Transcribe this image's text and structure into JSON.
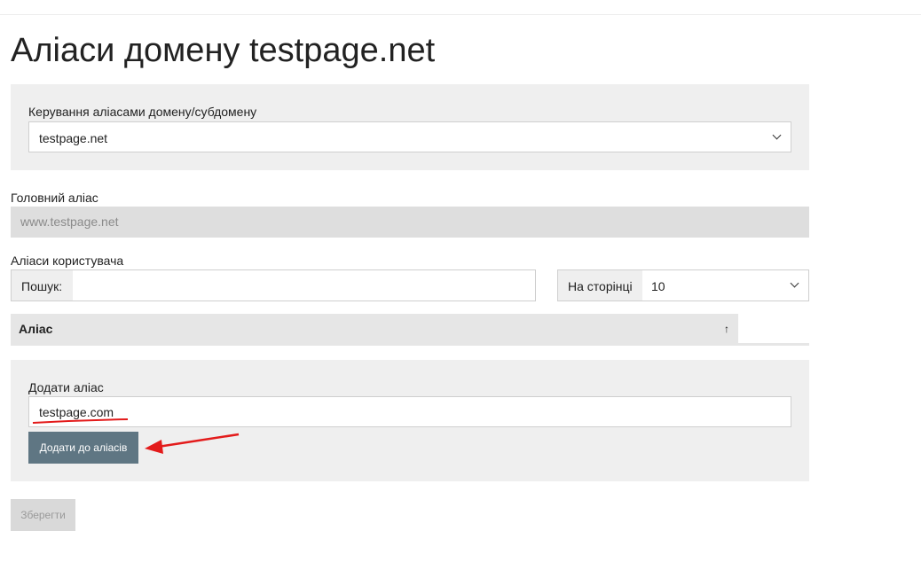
{
  "page": {
    "title": "Аліаси домену testpage.net"
  },
  "domain_select": {
    "label": "Керування аліасами домену/субдомену",
    "value": "testpage.net"
  },
  "main_alias": {
    "label": "Головний аліас",
    "value": "www.testpage.net"
  },
  "user_aliases": {
    "label": "Аліаси користувача",
    "search_label": "Пошук:",
    "search_value": "",
    "per_page_label": "На сторінці",
    "per_page_value": "10",
    "table": {
      "columns": [
        {
          "label": "Аліас",
          "sort_indicator": "↑"
        }
      ],
      "rows": []
    }
  },
  "add_alias": {
    "label": "Додати аліас",
    "value": "testpage.com",
    "button_label": "Додати до аліасів"
  },
  "footer": {
    "save_label": "Зберегти"
  },
  "colors": {
    "panel_bg": "#efefef",
    "primary_button": "#5f7683",
    "disabled_button": "#d9d9d9",
    "annotation_red": "#e31b1b"
  }
}
